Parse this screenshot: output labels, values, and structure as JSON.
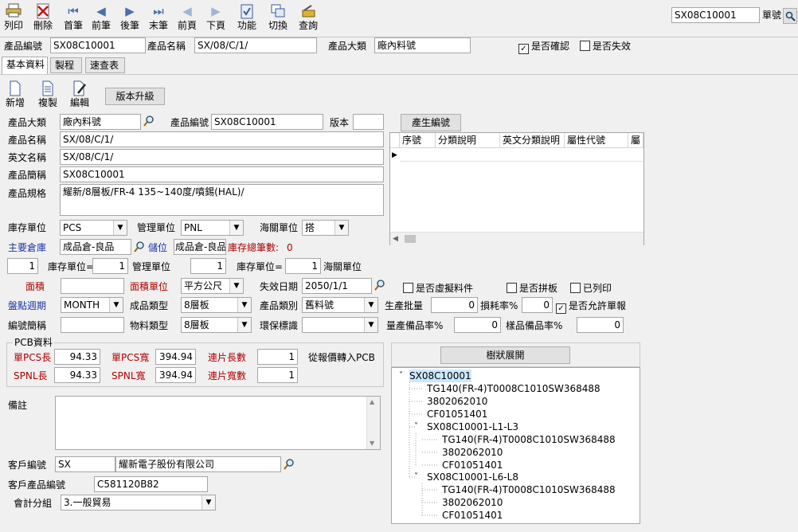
{
  "toolbar": {
    "print": "列印",
    "delete": "刪除",
    "first": "首筆",
    "prev": "前筆",
    "next": "後筆",
    "last": "末筆",
    "prev_page": "前頁",
    "next_page": "下頁",
    "function": "功能",
    "switch": "切換",
    "query": "查詢",
    "doc_no_value": "SX08C10001",
    "doc_no_label": "單號"
  },
  "header": {
    "product_code_label": "產品編號",
    "product_code_value": "SX08C10001",
    "product_name_label": "產品名稱",
    "product_name_value": "SX/08/C/1/",
    "category_label": "產品大類",
    "category_value": "廠內料號",
    "confirmed_label": "是否確認",
    "confirmed_mark": "✓",
    "invalid_label": "是否失效"
  },
  "tabs": [
    "基本資料",
    "製程",
    "速查表"
  ],
  "subtoolbar": {
    "add": "新增",
    "copy": "複製",
    "edit": "編輯",
    "upgrade": "版本升級"
  },
  "form": {
    "category_label": "產品大類",
    "category_value": "廠內料號",
    "code_label": "產品編號",
    "code_value": "SX08C10001",
    "version_label": "版本",
    "version_value": "",
    "gen_code_button": "產生編號",
    "name_label": "產品名稱",
    "name_value": "SX/08/C/1/",
    "ename_label": "英文名稱",
    "ename_value": "SX/08/C/1/",
    "short_label": "產品簡稱",
    "short_value": "SX08C10001",
    "spec_label": "產品規格",
    "spec_value": "耀新/8層板/FR-4 135~140度/噴錫(HAL)/",
    "stock_unit_label": "庫存單位",
    "stock_unit_value": "PCS",
    "mgmt_unit_label": "管理單位",
    "mgmt_unit_value": "PNL",
    "customs_unit_label": "海關單位",
    "customs_unit_value": "搭",
    "main_wh_label": "主要倉庫",
    "main_wh_value": "成品倉-良品",
    "location_label": "儲位",
    "location_value": "成品倉-良品",
    "stock_total_label": "庫存總筆數:",
    "stock_total_value": "0",
    "conv1_value": "1",
    "conv1_label": "庫存單位=",
    "conv2_value": "1",
    "conv2_label": "管理單位",
    "conv3_value": "1",
    "conv3_label": "庫存單位=",
    "conv4_value": "1",
    "conv4_label": "海關單位",
    "area_label": "面積",
    "area_value": "",
    "area_unit_label": "面積單位",
    "area_unit_value": "平方公尺",
    "expiry_label": "失效日期",
    "expiry_value": "2050/1/1",
    "virtual_label": "是否虛擬料件",
    "panel_label": "是否拼板",
    "printed_label": "已列印",
    "cycle_label": "盤點週期",
    "cycle_value": "MONTH",
    "prod_type_label": "成品類型",
    "prod_type_value": "8層板",
    "prod_class_label": "產品類別",
    "prod_class_value": "舊料號",
    "batch_label": "生產批量",
    "batch_value": "0",
    "loss_label": "損耗率%",
    "loss_value": "0",
    "allow_report_label": "是否允許單報",
    "allow_report_mark": "✓",
    "code_short_label": "編號簡稱",
    "code_short_value": "",
    "mat_type_label": "物料類型",
    "mat_type_value": "8層板",
    "env_label": "環保標識",
    "env_value": "",
    "yield_label": "量產備品率%",
    "yield_value": "0",
    "sample_label": "樣品備品率%",
    "sample_value": "0"
  },
  "grid": {
    "headers": [
      "序號",
      "分類說明",
      "英文分類說明",
      "屬性代號",
      "屬"
    ]
  },
  "pcb": {
    "group_label": "PCB資料",
    "pcs_len_label": "單PCS長",
    "pcs_len_value": "94.33",
    "pcs_wid_label": "單PCS寬",
    "pcs_wid_value": "394.94",
    "len_count_label": "連片長數",
    "len_count_value": "1",
    "import_label": "從報價轉入PCB",
    "spnl_len_label": "SPNL長",
    "spnl_len_value": "94.33",
    "spnl_wid_label": "SPNL寬",
    "spnl_wid_value": "394.94",
    "wid_count_label": "連片寬數",
    "wid_count_value": "1"
  },
  "remark_label": "備註",
  "customer": {
    "code_label": "客戶編號",
    "code_value": "SX",
    "name_value": "耀新電子股份有限公司",
    "part_label": "客戶產品編號",
    "part_value": "C581120B82",
    "acct_label": "會計分組",
    "acct_value": "3.一般貿易"
  },
  "tree": {
    "button": "樹狀展開",
    "root": "SX08C10001",
    "level1": [
      "TG140(FR-4)T0008C1010SW368488",
      "3802062010",
      "CF01051401"
    ],
    "group1": "SX08C10001-L1-L3",
    "group1_items": [
      "TG140(FR-4)T0008C1010SW368488",
      "3802062010",
      "CF01051401"
    ],
    "group2": "SX08C10001-L6-L8",
    "group2_items": [
      "TG140(FR-4)T0008C1010SW368488",
      "3802062010",
      "CF01051401"
    ]
  }
}
